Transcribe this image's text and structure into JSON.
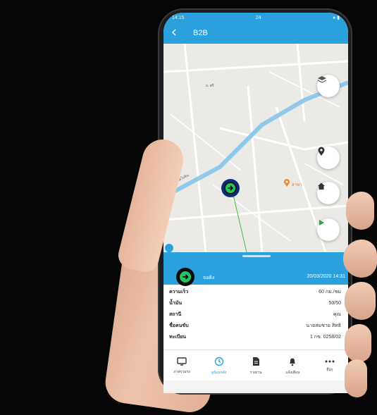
{
  "status_bar": {
    "time": "14:15",
    "icons": "24",
    "right": "● ▮"
  },
  "app_bar": {
    "back_icon": "arrow-left-icon",
    "title": "B2B"
  },
  "map": {
    "road_main": "ถนนพหลโยธิน",
    "road_top": "ถ. สรี",
    "poi_label": "สาขา"
  },
  "panel": {
    "status_text": "จอดิง",
    "timestamp": "20/03/2020  14:31"
  },
  "details": [
    {
      "label": "ความเร็ว",
      "value": "60 กม./ชม"
    },
    {
      "label": "น้ำมัน",
      "value": "50/50"
    },
    {
      "label": "สถานี",
      "value": "คุณ"
    },
    {
      "label": "ชื่อคนขับ",
      "value": "นายสมชาย สิทธิ"
    },
    {
      "label": "ทะเบียน",
      "value": "1 กข. 0258/02"
    }
  ],
  "nav": [
    {
      "label": "ภาพรวมรถ",
      "icon": "monitor-icon"
    },
    {
      "label": "ดูย้อนหลัง",
      "icon": "history-icon"
    },
    {
      "label": "รายงาน",
      "icon": "document-icon"
    },
    {
      "label": "แจ้งเตือน",
      "icon": "bell-icon"
    },
    {
      "label": "อื่นๆ",
      "icon": "more-icon"
    }
  ],
  "colors": {
    "primary": "#2aa0dc",
    "route": "#8fc9ea",
    "status": "#22c55e"
  }
}
